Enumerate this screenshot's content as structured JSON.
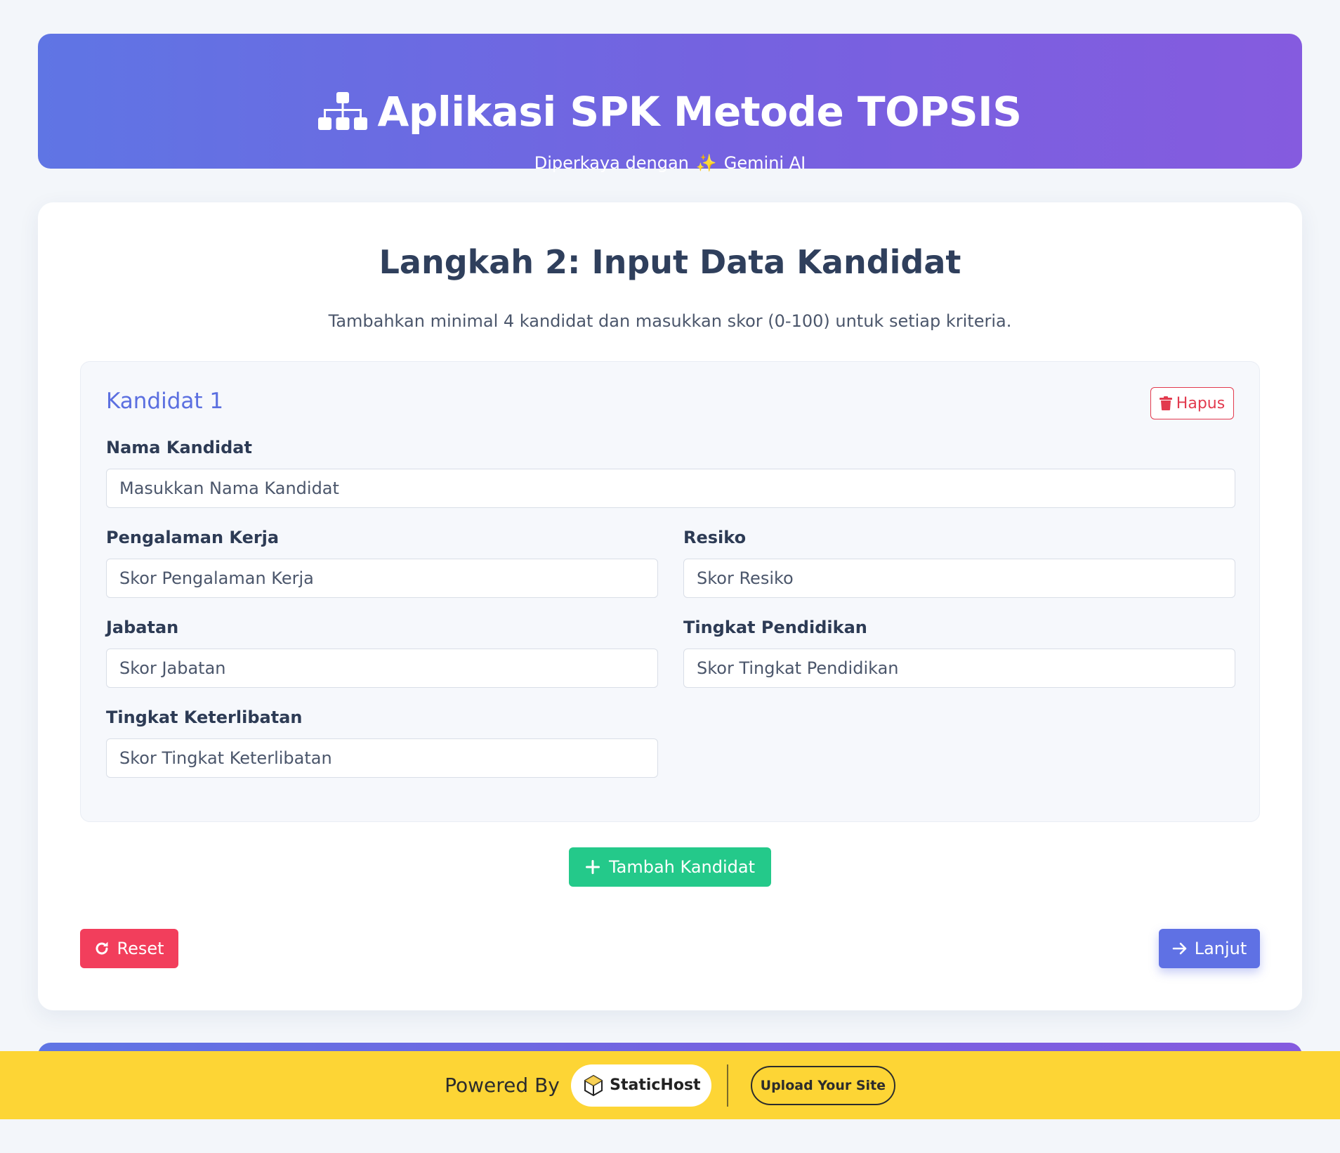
{
  "header": {
    "title": "Aplikasi SPK Metode TOPSIS",
    "subtitle_prefix": "Diperkaya dengan",
    "subtitle_emoji": "✨",
    "subtitle_suffix": "Gemini AI"
  },
  "step": {
    "title": "Langkah 2: Input Data Kandidat",
    "description": "Tambahkan minimal 4 kandidat dan masukkan skor (0-100) untuk setiap kriteria."
  },
  "kandidat": {
    "title": "Kandidat 1",
    "delete_label": "Hapus",
    "fields": {
      "nama": {
        "label": "Nama Kandidat",
        "placeholder": "Masukkan Nama Kandidat",
        "value": ""
      },
      "pengalaman": {
        "label": "Pengalaman Kerja",
        "placeholder": "Skor Pengalaman Kerja",
        "value": ""
      },
      "resiko": {
        "label": "Resiko",
        "placeholder": "Skor Resiko",
        "value": ""
      },
      "jabatan": {
        "label": "Jabatan",
        "placeholder": "Skor Jabatan",
        "value": ""
      },
      "pendidikan": {
        "label": "Tingkat Pendidikan",
        "placeholder": "Skor Tingkat Pendidikan",
        "value": ""
      },
      "keterlibatan": {
        "label": "Tingkat Keterlibatan",
        "placeholder": "Skor Tingkat Keterlibatan",
        "value": ""
      }
    }
  },
  "actions": {
    "add_label": "Tambah Kandidat",
    "reset_label": "Reset",
    "next_label": "Lanjut"
  },
  "powered": {
    "text": "Powered By",
    "brand": "StaticHost",
    "upload_label": "Upload Your Site"
  },
  "colors": {
    "accent": "#5f71e4",
    "success": "#24c98a",
    "danger": "#f23e5c",
    "banner": "#fdd535"
  }
}
